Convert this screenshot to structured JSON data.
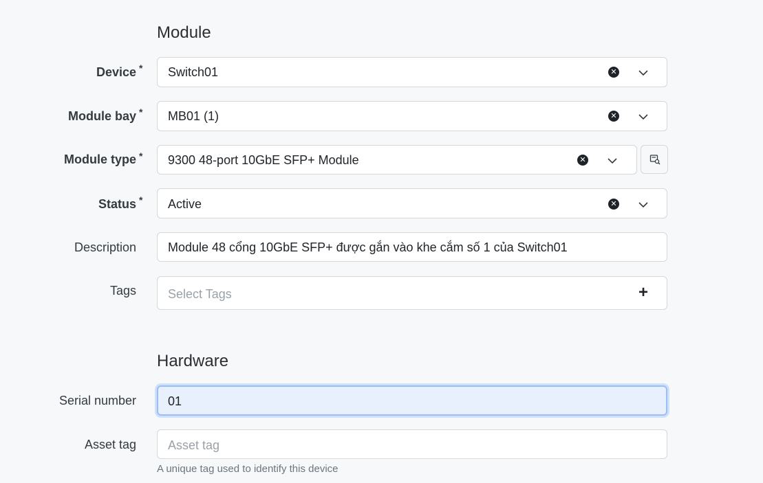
{
  "sections": {
    "module": "Module",
    "hardware": "Hardware"
  },
  "fields": {
    "device": {
      "label": "Device",
      "value": "Switch01",
      "required": "*"
    },
    "module_bay": {
      "label": "Module bay",
      "value": "MB01 (1)",
      "required": "*"
    },
    "module_type": {
      "label": "Module type",
      "value": "9300 48-port 10GbE SFP+ Module",
      "required": "*"
    },
    "status": {
      "label": "Status",
      "value": "Active",
      "required": "*"
    },
    "description": {
      "label": "Description",
      "value": "Module 48 cổng 10GbE SFP+ được gắn vào khe cắm số 1 của Switch01"
    },
    "tags": {
      "label": "Tags",
      "placeholder": "Select Tags"
    },
    "serial_number": {
      "label": "Serial number",
      "value": "01"
    },
    "asset_tag": {
      "label": "Asset tag",
      "placeholder": "Asset tag",
      "help": "A unique tag used to identify this device"
    }
  },
  "icons": {
    "clear": "clear-icon",
    "chevron": "chevron-down-icon",
    "plus": "plus-icon",
    "lookup": "search-list-icon"
  }
}
